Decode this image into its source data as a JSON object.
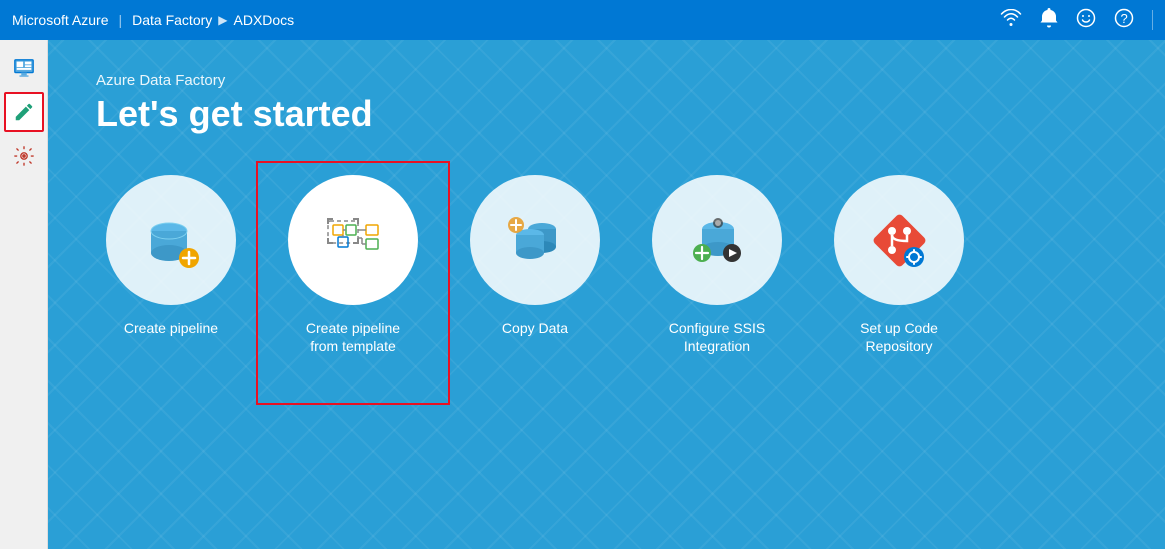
{
  "topbar": {
    "brand": "Microsoft Azure",
    "divider": "|",
    "breadcrumb": [
      "Data Factory",
      "ADXDocs"
    ],
    "icons": [
      "wifi-icon",
      "bell-icon",
      "smiley-icon",
      "help-icon"
    ]
  },
  "sidebar": {
    "items": [
      {
        "id": "monitor-icon",
        "label": "Monitor",
        "active": false
      },
      {
        "id": "author-icon",
        "label": "Author",
        "active": true
      },
      {
        "id": "configure-icon",
        "label": "Configure",
        "active": false
      }
    ]
  },
  "content": {
    "subtitle": "Azure Data Factory",
    "title": "Let's get started",
    "cards": [
      {
        "id": "create-pipeline",
        "label": "Create pipeline",
        "highlighted": false
      },
      {
        "id": "create-pipeline-template",
        "label": "Create pipeline\nfrom template",
        "highlighted": true
      },
      {
        "id": "copy-data",
        "label": "Copy Data",
        "highlighted": false
      },
      {
        "id": "configure-ssis",
        "label": "Configure SSIS\nIntegration",
        "highlighted": false
      },
      {
        "id": "setup-code-repo",
        "label": "Set up Code\nRepository",
        "highlighted": false
      }
    ]
  }
}
